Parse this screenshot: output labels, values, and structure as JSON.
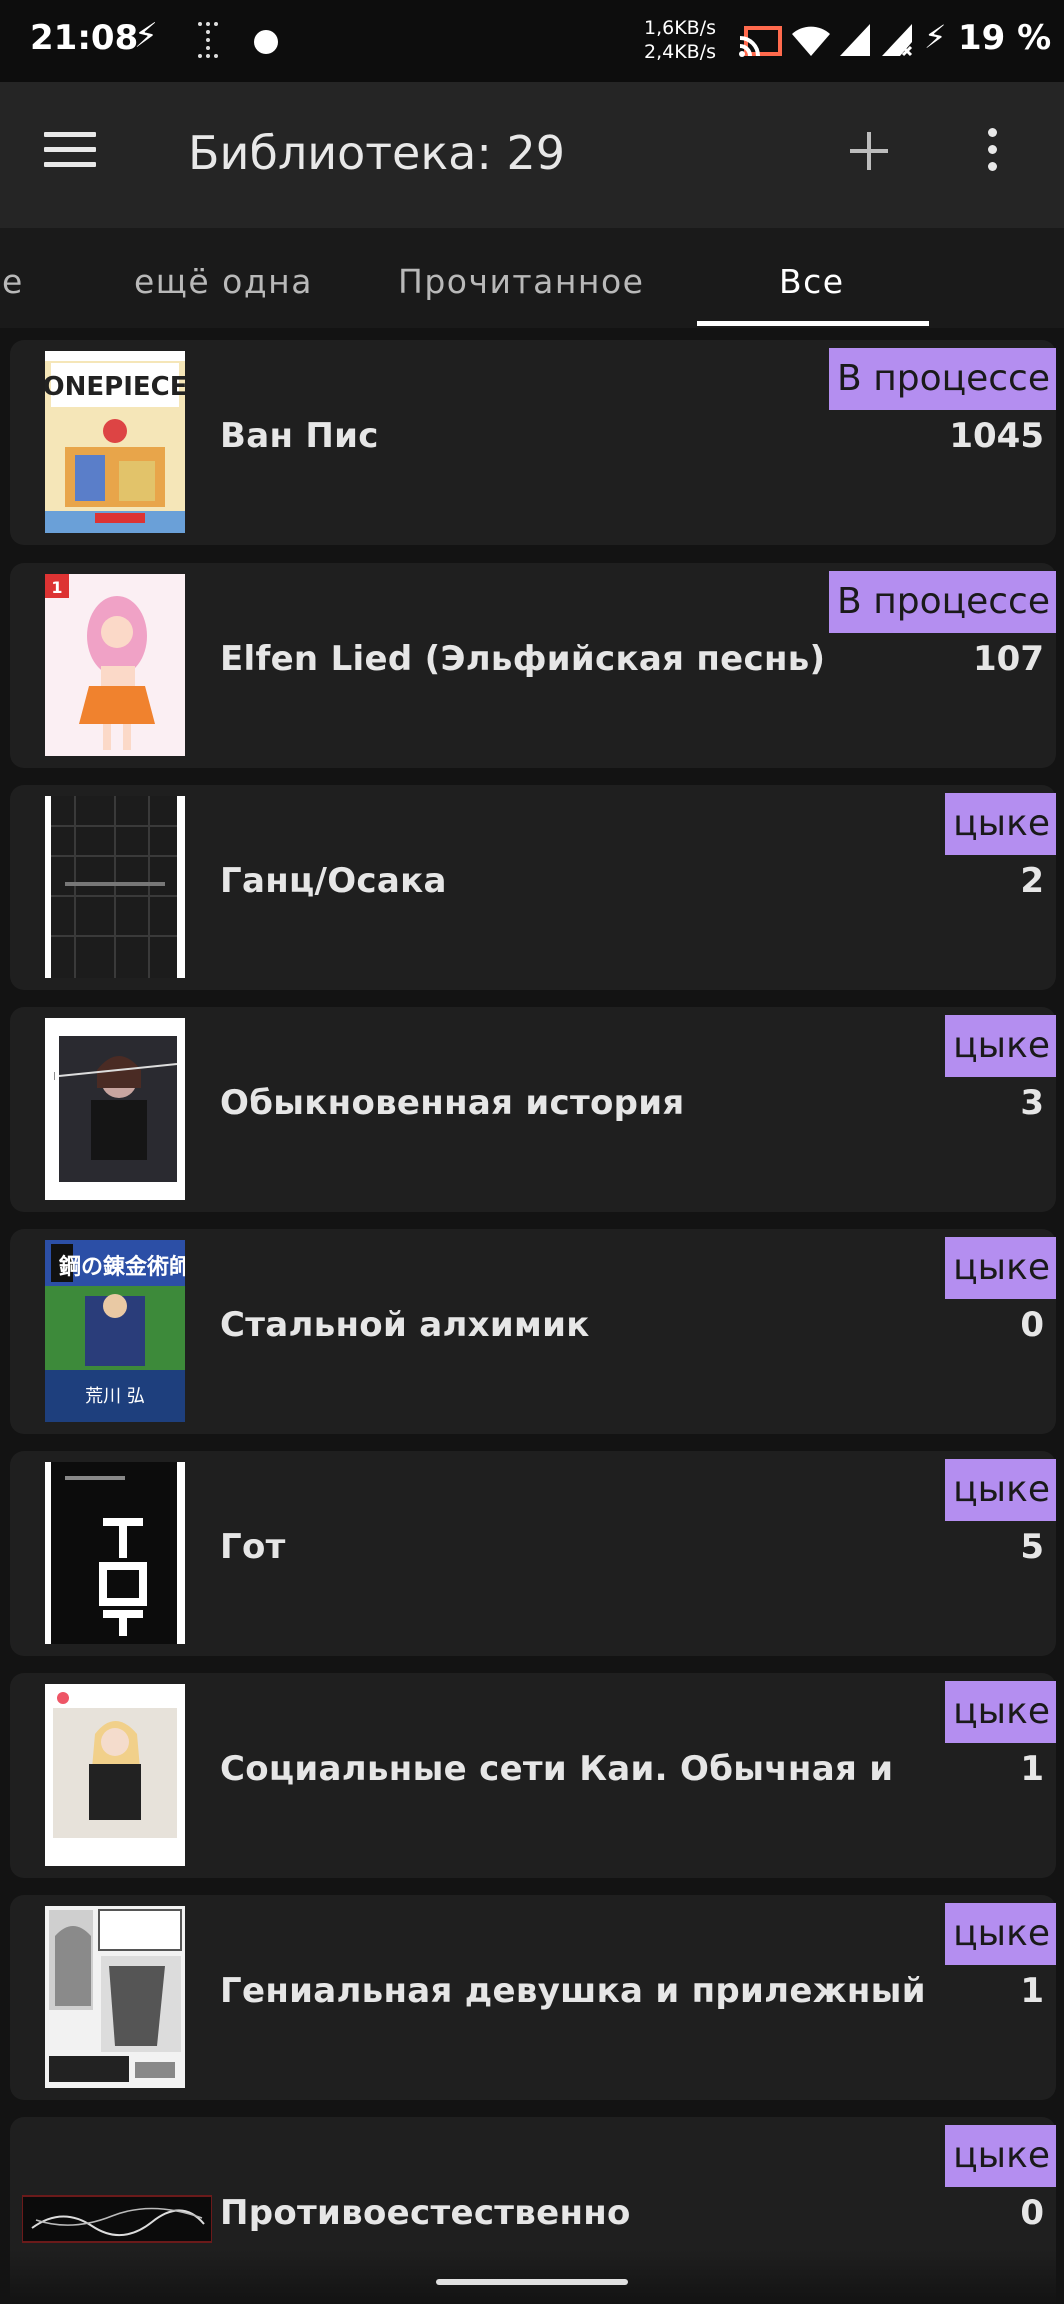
{
  "status_bar": {
    "time": "21:08",
    "net_up": "1,6KB/s",
    "net_down": "2,4KB/s",
    "battery": "19 %"
  },
  "app_bar": {
    "title": "Библиотека: 29"
  },
  "tabs": [
    {
      "label": "е",
      "active": false
    },
    {
      "label": "ещё одна",
      "active": false
    },
    {
      "label": "Прочитанное",
      "active": false
    },
    {
      "label": "Все",
      "active": true
    }
  ],
  "manga": [
    {
      "title": "Ван Пис",
      "status": "В процессе",
      "count": "1045",
      "cover": "cover-one-piece"
    },
    {
      "title": "Elfen Lied (Эльфийская песнь)",
      "status": "В процессе",
      "count": "107",
      "cover": "cover-elfen-lied"
    },
    {
      "title": "Ганц/Осака",
      "status": "цыке",
      "count": "2",
      "cover": "cover-gantz"
    },
    {
      "title": "Обыкновенная история",
      "status": "цыке",
      "count": "3",
      "cover": "cover-ordinary-story"
    },
    {
      "title": "Стальной алхимик",
      "status": "цыке",
      "count": "0",
      "cover": "cover-fma"
    },
    {
      "title": "Гот",
      "status": "цыке",
      "count": "5",
      "cover": "cover-goth"
    },
    {
      "title": "Социальные сети Каи. Обычная и",
      "status": "цыке",
      "count": "1",
      "cover": "cover-kai"
    },
    {
      "title": "Гениальная девушка и прилежный",
      "status": "цыке",
      "count": "1",
      "cover": "cover-genius-girl"
    },
    {
      "title": "Противоестественно",
      "status": "цыке",
      "count": "0",
      "cover": "cover-unnatural"
    }
  ],
  "colors": {
    "badge": "#b48ef0",
    "background": "#131313",
    "card": "#1f1f1f",
    "app_bar": "#252525"
  }
}
